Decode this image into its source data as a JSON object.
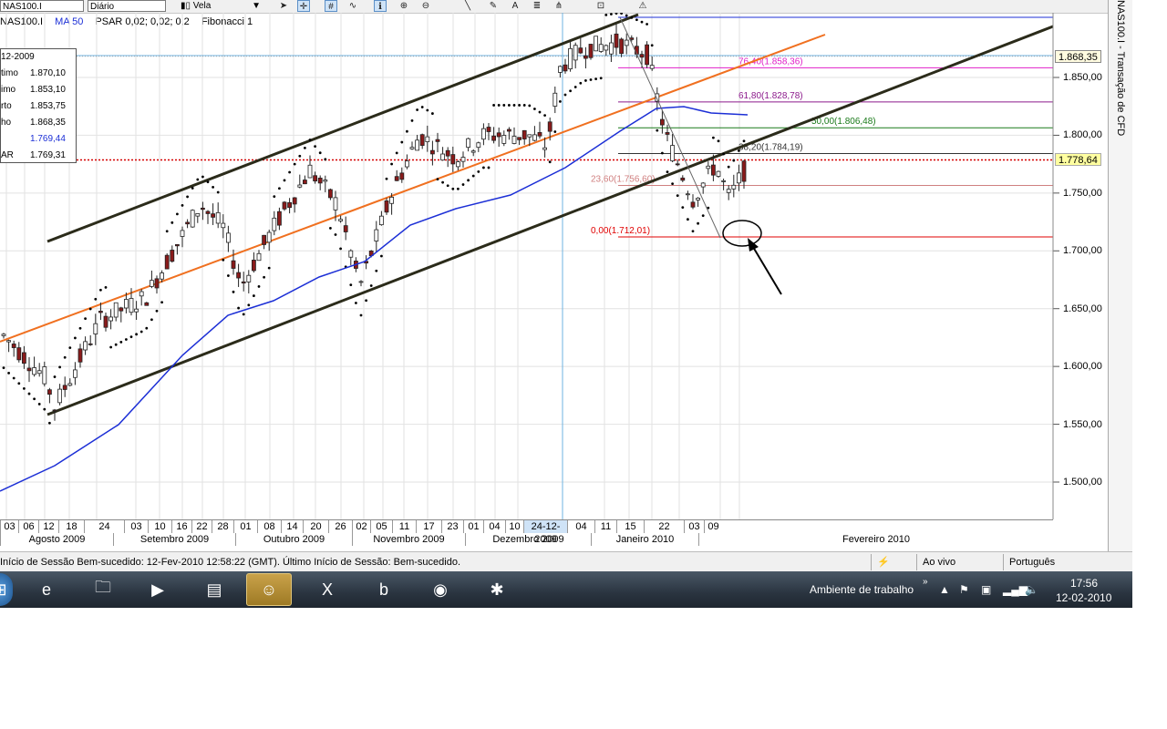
{
  "toolbar": {
    "symbol": "NAS100.I",
    "period": "Diário",
    "chart_type": "Vela",
    "icons": [
      "cursor-icon",
      "crosshair-icon",
      "grid-icon",
      "wave-icon",
      "data-window-icon",
      "zoom-in-icon",
      "zoom-out-icon",
      "line-icon",
      "pencil-icon",
      "text-icon",
      "fibonacci-icon",
      "magnet-icon",
      "zoom-fit-icon",
      "lock-icon"
    ]
  },
  "indicators": {
    "symbol": "NAS100.I",
    "ma": "MA 50",
    "psar": "PSAR 0,02; 0,02; 0,2",
    "fib": "Fibonacci 1"
  },
  "data_window": {
    "date": "12-2009",
    "rows": [
      {
        "label": "timo",
        "value": "1.870,10",
        "color": "#000000"
      },
      {
        "label": "imo",
        "value": "1.853,10",
        "color": "#000000"
      },
      {
        "label": "rto",
        "value": "1.853,75",
        "color": "#000000"
      },
      {
        "label": "ho",
        "value": "1.868,35",
        "color": "#000000"
      },
      {
        "label": "",
        "value": "1.769,44",
        "color": "#1c2fd6"
      },
      {
        "label": "AR",
        "value": "1.769,31",
        "color": "#000000"
      }
    ]
  },
  "price_axis": {
    "ticks": [
      "1.850,00",
      "1.800,00",
      "1.750,00",
      "1.700,00",
      "1.650,00",
      "1.600,00",
      "1.550,00",
      "1.500,00"
    ],
    "top_tag": "1.868,35",
    "current_tag": "1.778,64",
    "current_color": "#d40000"
  },
  "fib_levels": [
    {
      "label": "76,40(1.858,36)",
      "color": "#e020c8"
    },
    {
      "label": "61,80(1.828,78)",
      "color": "#8c1a8c"
    },
    {
      "label": "50,00(1.806,48)",
      "color": "#1a7a1a"
    },
    {
      "label": "38,20(1.784,19)",
      "color": "#333333"
    },
    {
      "label": "23,60(1.756,60)",
      "color": "#d08080"
    },
    {
      "label": "0,00(1.712,01)",
      "color": "#e00000"
    }
  ],
  "x_axis": {
    "days": [
      "03",
      "06",
      "12",
      "18",
      "24",
      "03",
      "10",
      "16",
      "22",
      "28",
      "01",
      "08",
      "14",
      "20",
      "26",
      "02",
      "05",
      "11",
      "17",
      "23",
      "01",
      "04",
      "10",
      "24-12-2009",
      "04",
      "11",
      "15",
      "22",
      "03",
      "09"
    ],
    "months": [
      "Agosto 2009",
      "Setembro 2009",
      "Outubro 2009",
      "Novembro 2009",
      "Dezembro 2009",
      "Janeiro 2010",
      "Fevereiro 2010"
    ]
  },
  "side_tab": {
    "title": "NAS100.I - Transação de CFD"
  },
  "status": {
    "message": "Início de Sessão Bem-sucedido: 12-Fev-2010 12:58:22 (GMT). Último Início de Sessão: Bem-sucedido.",
    "mode": "Ao vivo",
    "language": "Português"
  },
  "taskbar": {
    "apps": [
      "ie-icon",
      "explorer-icon",
      "media-player-icon",
      "notes-icon",
      "messenger-icon",
      "excel-icon",
      "bank-b-icon",
      "firefox-icon",
      "paint-icon"
    ],
    "desktop_label": "Ambiente de trabalho",
    "time": "17:56",
    "date": "12-02-2010"
  },
  "colors": {
    "channel": "#2b2b1a",
    "trend": "#f07020",
    "ma": "#1c2fd6",
    "crosshair": "#6fb3e0"
  }
}
